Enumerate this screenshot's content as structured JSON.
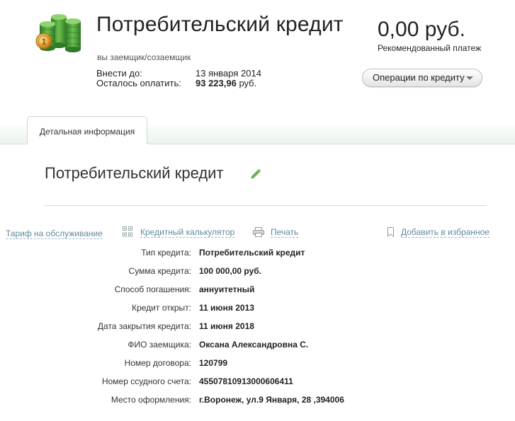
{
  "header": {
    "title": "Потребительский кредит",
    "role": "вы заемщик/созаемщик",
    "amount": "0,00 руб.",
    "amount_caption": "Рекомендованный платеж",
    "pay_label": "Внести до:",
    "pay_value": "13 января 2014",
    "remain_label": "Осталось оплатить:",
    "remain_value": "93 223,96",
    "remain_currency": " руб.",
    "ops_button": "Операции по кредиту"
  },
  "tabs": [
    {
      "label": "Детальная информация",
      "active": true
    }
  ],
  "product": {
    "title": "Потребительский кредит"
  },
  "links": {
    "tariff": "Тариф на обслуживание",
    "calculator": "Кредитный калькулятор",
    "print": "Печать",
    "favorite": "Добавить в избранное"
  },
  "details": [
    {
      "label": "Тип кредита:",
      "value": "Потребительский кредит"
    },
    {
      "label": "Сумма кредита:",
      "value": "100 000,00 руб."
    },
    {
      "label": "Способ погашения:",
      "value": "аннуитетный"
    },
    {
      "label": "Кредит открыт:",
      "value": "11 июня 2013"
    },
    {
      "label": "Дата закрытия кредита:",
      "value": "11 июня 2018"
    },
    {
      "label": "ФИО заемщика:",
      "value": "Оксана Александровна С."
    },
    {
      "label": "Номер договора:",
      "value": "120799"
    },
    {
      "label": "Номер ссудного счета:",
      "value": "45507810913000606411"
    },
    {
      "label": "Место оформления:",
      "value": "г.Воронеж, ул.9 Января, 28 ,394006"
    }
  ],
  "colors": {
    "link": "#5f8a9e",
    "tab_band": "#eaf4ea",
    "coin_gold": "#e0a030",
    "stack_green": "#4a9a3a"
  },
  "icons": {
    "logo": "coin-stacks-icon",
    "edit": "pencil-icon",
    "calculator": "calculator-icon",
    "print": "printer-icon",
    "favorite": "bookmark-icon"
  }
}
